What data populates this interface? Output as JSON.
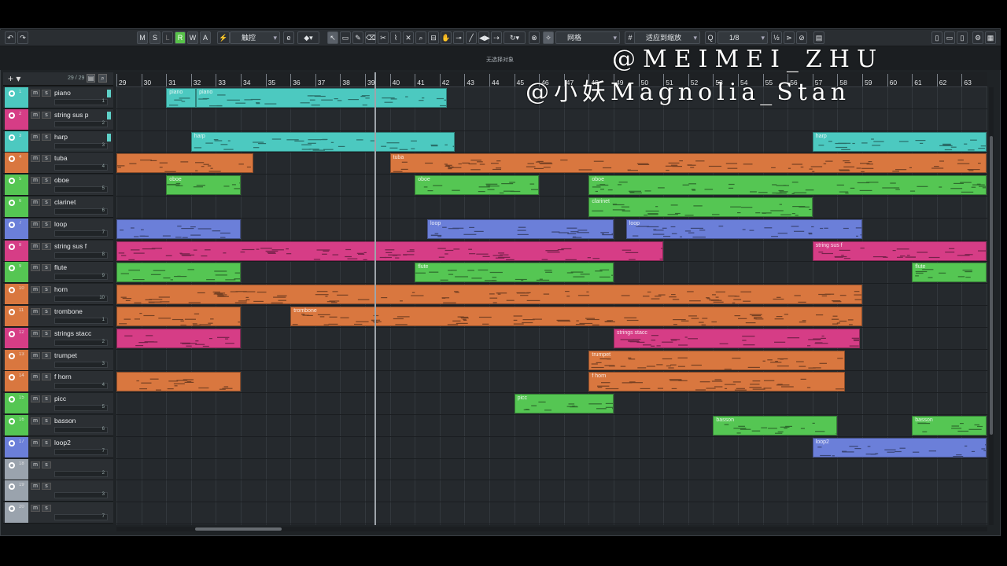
{
  "toolbar": {
    "buttons": [
      "M",
      "S",
      "L",
      "R",
      "W",
      "A"
    ],
    "touch_mode": "触控",
    "snap_type": "网格",
    "snap_mode": "适应到缩放",
    "quantize": "1/8"
  },
  "status_text": "无选择对象",
  "tracklist": {
    "count": "29 / 29"
  },
  "tracks": [
    {
      "num": "1",
      "name": "piano",
      "color": "#4cc9c0",
      "channel": "1"
    },
    {
      "num": "2",
      "name": "string sus p",
      "color": "#d63d86",
      "channel": "2"
    },
    {
      "num": "3",
      "name": "harp",
      "color": "#4cc9c0",
      "channel": "3"
    },
    {
      "num": "4",
      "name": "tuba",
      "color": "#d9773f",
      "channel": "4"
    },
    {
      "num": "5",
      "name": "oboe",
      "color": "#55c653",
      "channel": "5"
    },
    {
      "num": "6",
      "name": "clarinet",
      "color": "#55c653",
      "channel": "6"
    },
    {
      "num": "7",
      "name": "loop",
      "color": "#6b7fd9",
      "channel": "7"
    },
    {
      "num": "8",
      "name": "string sus f",
      "color": "#d63d86",
      "channel": "8"
    },
    {
      "num": "9",
      "name": "flute",
      "color": "#55c653",
      "channel": "9"
    },
    {
      "num": "10",
      "name": "horn",
      "color": "#d9773f",
      "channel": "10"
    },
    {
      "num": "11",
      "name": "trombone",
      "color": "#d9773f",
      "channel": "1"
    },
    {
      "num": "12",
      "name": "strings stacc",
      "color": "#d63d86",
      "channel": "2"
    },
    {
      "num": "13",
      "name": "trumpet",
      "color": "#d9773f",
      "channel": "3"
    },
    {
      "num": "14",
      "name": "f horn",
      "color": "#d9773f",
      "channel": "4"
    },
    {
      "num": "15",
      "name": "picc",
      "color": "#55c653",
      "channel": "5"
    },
    {
      "num": "16",
      "name": "basson",
      "color": "#55c653",
      "channel": "6"
    },
    {
      "num": "17",
      "name": "loop2",
      "color": "#6b7fd9",
      "channel": "7"
    },
    {
      "num": "18",
      "name": "",
      "color": "#9aa3ad",
      "channel": "2"
    },
    {
      "num": "19",
      "name": "",
      "color": "#9aa3ad",
      "channel": "3"
    },
    {
      "num": "20",
      "name": "",
      "color": "#9aa3ad",
      "channel": "7"
    }
  ],
  "ruler": [
    "29",
    "30",
    "31",
    "32",
    "33",
    "34",
    "35",
    "36",
    "37",
    "38",
    "39",
    "40",
    "41",
    "42",
    "43",
    "44",
    "45",
    "46",
    "47",
    "48",
    "49",
    "50",
    "51",
    "52",
    "53",
    "54",
    "55",
    "56",
    "57",
    "58",
    "59",
    "60",
    "61",
    "62",
    "63"
  ],
  "parts": [
    {
      "track": 1,
      "start": 31,
      "end": 32.2,
      "label": "piano"
    },
    {
      "track": 1,
      "start": 32.2,
      "end": 42.3,
      "label": "piano"
    },
    {
      "track": 3,
      "start": 32,
      "end": 42.6,
      "label": "harp"
    },
    {
      "track": 3,
      "start": 57,
      "end": 64,
      "label": "harp"
    },
    {
      "track": 4,
      "start": 29,
      "end": 34.5,
      "label": ""
    },
    {
      "track": 4,
      "start": 40,
      "end": 64,
      "label": "tuba"
    },
    {
      "track": 5,
      "start": 31,
      "end": 34,
      "label": "oboe"
    },
    {
      "track": 5,
      "start": 41,
      "end": 46,
      "label": "oboe"
    },
    {
      "track": 5,
      "start": 48,
      "end": 64,
      "label": "oboe"
    },
    {
      "track": 6,
      "start": 48,
      "end": 57,
      "label": "clarinet"
    },
    {
      "track": 7,
      "start": 29,
      "end": 34,
      "label": ""
    },
    {
      "track": 7,
      "start": 41.5,
      "end": 49,
      "label": "loop"
    },
    {
      "track": 7,
      "start": 49.5,
      "end": 59,
      "label": "loop"
    },
    {
      "track": 8,
      "start": 29,
      "end": 51,
      "label": ""
    },
    {
      "track": 8,
      "start": 57,
      "end": 64,
      "label": "string sus f"
    },
    {
      "track": 9,
      "start": 29,
      "end": 34,
      "label": ""
    },
    {
      "track": 9,
      "start": 41,
      "end": 49,
      "label": "flute"
    },
    {
      "track": 9,
      "start": 61,
      "end": 64,
      "label": "flute"
    },
    {
      "track": 10,
      "start": 29,
      "end": 59,
      "label": ""
    },
    {
      "track": 11,
      "start": 29,
      "end": 34,
      "label": ""
    },
    {
      "track": 11,
      "start": 36,
      "end": 59,
      "label": "trombone"
    },
    {
      "track": 12,
      "start": 29,
      "end": 34,
      "label": ""
    },
    {
      "track": 12,
      "start": 49,
      "end": 58.9,
      "label": "strings stacc"
    },
    {
      "track": 13,
      "start": 48,
      "end": 58.3,
      "label": "trumpet"
    },
    {
      "track": 14,
      "start": 29,
      "end": 34,
      "label": ""
    },
    {
      "track": 14,
      "start": 48,
      "end": 58.3,
      "label": "f horn"
    },
    {
      "track": 15,
      "start": 45,
      "end": 49,
      "label": "picc"
    },
    {
      "track": 16,
      "start": 53,
      "end": 58,
      "label": "basson"
    },
    {
      "track": 16,
      "start": 61,
      "end": 64,
      "label": "basson"
    },
    {
      "track": 17,
      "start": 57,
      "end": 64,
      "label": "loop2"
    }
  ],
  "watermark": {
    "line1": "@MEIMEI_ZHU",
    "line2": "@小妖Magnolia_Stan"
  },
  "colors": {
    "cyan": "#4cc9c0",
    "pink": "#d63d86",
    "orange": "#d9773f",
    "green": "#55c653",
    "blue": "#6b7fd9",
    "empty": "#9aa3ad"
  }
}
